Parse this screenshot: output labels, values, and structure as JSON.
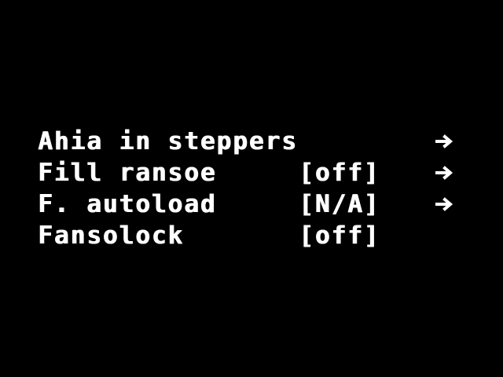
{
  "menu": {
    "items": [
      {
        "label": "Ahia in steppers",
        "value": "",
        "icon": "arrow-right-icon"
      },
      {
        "label": "Fill ransoe",
        "value": "[off]",
        "icon": "arrow-right-icon"
      },
      {
        "label": "F. autoload",
        "value": "[N/A]",
        "icon": "arrow-right-icon"
      },
      {
        "label": "Fansolock",
        "value": "[off]",
        "icon": ""
      }
    ]
  },
  "colors": {
    "background": "#000000",
    "foreground": "#ffffff"
  }
}
